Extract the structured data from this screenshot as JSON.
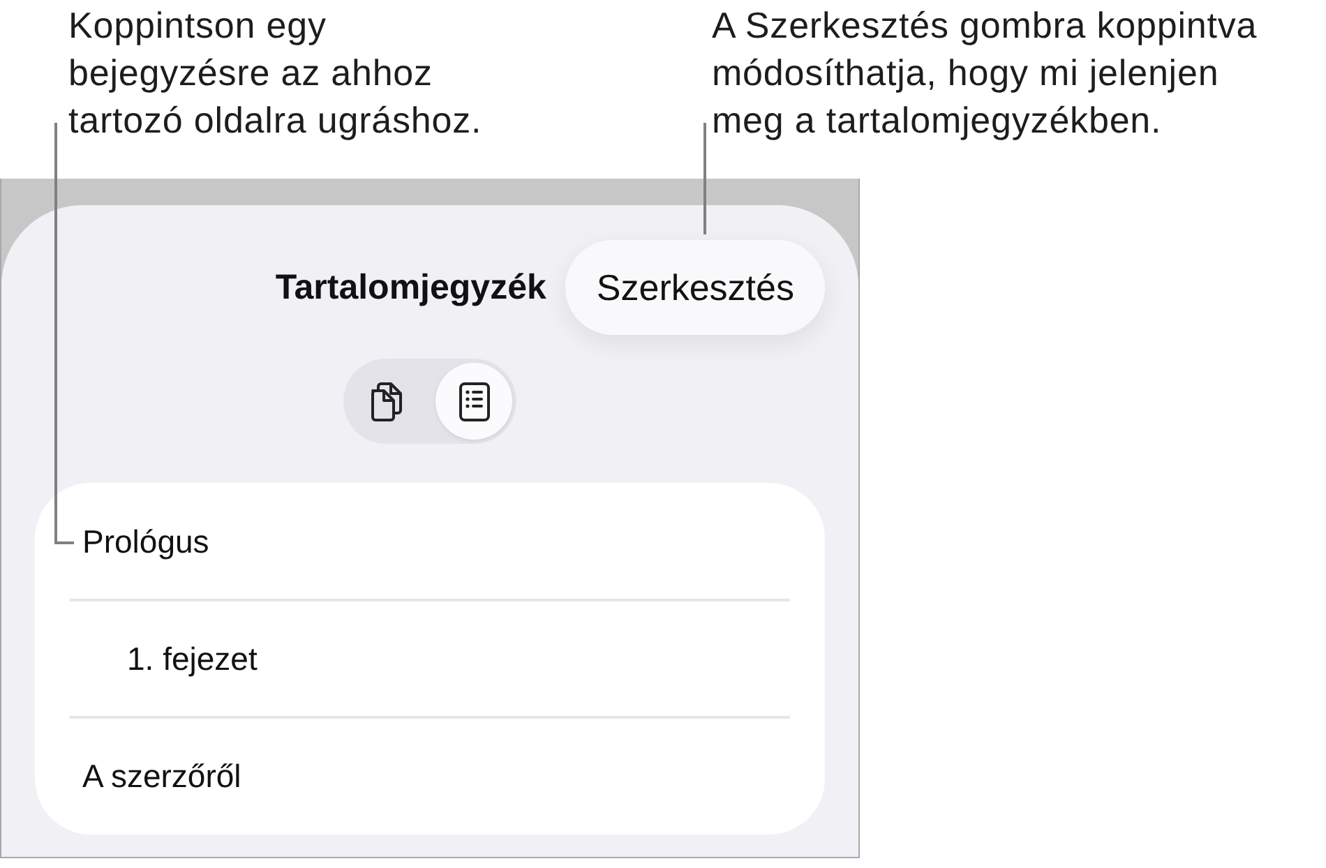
{
  "callouts": [
    {
      "text": "Koppintson egy\nbejegyzésre az ahhoz\ntartozó oldalra ugráshoz."
    },
    {
      "text": "A Szerkesztés gombra koppintva\nmódosíthatja, hogy mi jelenjen\nmeg a tartalomjegyzékben."
    }
  ],
  "sheet": {
    "title": "Tartalomjegyzék",
    "edit_button": "Szerkesztés",
    "view_toggle": [
      {
        "kind": "pages",
        "selected": false
      },
      {
        "kind": "contents",
        "selected": true
      }
    ],
    "entries": [
      {
        "label": "Prológus",
        "children": [
          {
            "label": "1. fejezet"
          }
        ]
      },
      {
        "label": "A szerzőről"
      }
    ]
  }
}
